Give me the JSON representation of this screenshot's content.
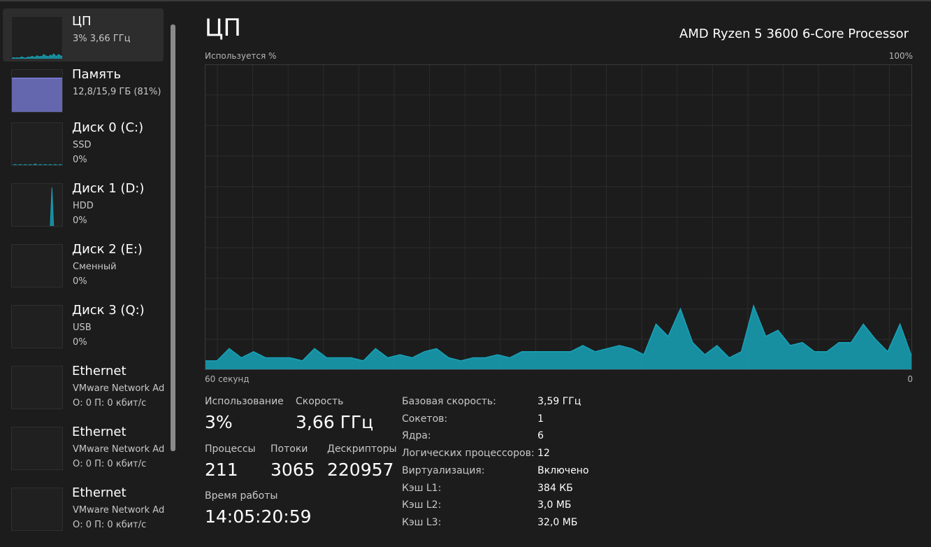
{
  "sidebar": {
    "items": [
      {
        "name": "ЦП",
        "line1": "3%  3,66 ГГц",
        "line2": "",
        "graph": "cpu",
        "color": "#17a2b8",
        "selected": true
      },
      {
        "name": "Память",
        "line1": "12,8/15,9 ГБ (81%)",
        "line2": "",
        "graph": "memory",
        "color": "#7b7fdc",
        "fill_fraction": 0.81
      },
      {
        "name": "Диск 0 (C:)",
        "line1": "SSD",
        "line2": "0%",
        "graph": "disk0",
        "color": "#17a2b8"
      },
      {
        "name": "Диск 1 (D:)",
        "line1": "HDD",
        "line2": "0%",
        "graph": "disk1",
        "color": "#17a2b8"
      },
      {
        "name": "Диск 2 (E:)",
        "line1": "Сменный",
        "line2": "0%",
        "graph": "disk2",
        "color": "#17a2b8"
      },
      {
        "name": "Диск 3 (Q:)",
        "line1": "USB",
        "line2": "0%",
        "graph": "disk3",
        "color": "#17a2b8"
      },
      {
        "name": "Ethernet",
        "line1": "VMware Network Ad",
        "line2": "О: 0  П: 0 кбит/с",
        "graph": "net",
        "color": "#c586c0"
      },
      {
        "name": "Ethernet",
        "line1": "VMware Network Ad",
        "line2": "О: 0  П: 0 кбит/с",
        "graph": "net",
        "color": "#c586c0"
      },
      {
        "name": "Ethernet",
        "line1": "VMware Network Ad",
        "line2": "О: 0  П: 0 кбит/с",
        "graph": "net",
        "color": "#c586c0"
      }
    ]
  },
  "header": {
    "title": "ЦП",
    "cpu_model": "AMD Ryzen 5 3600 6-Core Processor"
  },
  "chart_labels": {
    "y_label": "Используется %",
    "y_max": "100%",
    "x_left": "60 секунд",
    "x_right": "0"
  },
  "chart_data": {
    "type": "area",
    "title": "",
    "ylabel": "Используется %",
    "xlabel": "60 секунд",
    "ylim": [
      0,
      100
    ],
    "x_range_seconds": [
      60,
      0
    ],
    "grid": true,
    "color": "#17a2b8",
    "series": [
      {
        "values": [
          3,
          3,
          7,
          4,
          6,
          4,
          4,
          4,
          3,
          7,
          4,
          4,
          4,
          3,
          7,
          4,
          5,
          4,
          6,
          7,
          4,
          3,
          4,
          4,
          5,
          4,
          6,
          6,
          6,
          6,
          6,
          8,
          6,
          7,
          8,
          7,
          5,
          15,
          11,
          20,
          9,
          5,
          8,
          4,
          6,
          21,
          11,
          13,
          8,
          9,
          6,
          6,
          9,
          9,
          15,
          10,
          6,
          15,
          4
        ]
      }
    ]
  },
  "stats": {
    "utilization_label": "Использование",
    "utilization_value": "3%",
    "speed_label": "Скорость",
    "speed_value": "3,66 ГГц",
    "processes_label": "Процессы",
    "processes_value": "211",
    "threads_label": "Потоки",
    "threads_value": "3065",
    "handles_label": "Дескрипторы",
    "handles_value": "220957",
    "uptime_label": "Время работы",
    "uptime_value": "14:05:20:59"
  },
  "specs": [
    {
      "label": "Базовая скорость:",
      "value": "3,59 ГГц"
    },
    {
      "label": "Сокетов:",
      "value": "1"
    },
    {
      "label": "Ядра:",
      "value": "6"
    },
    {
      "label": "Логических процессоров:",
      "value": "12"
    },
    {
      "label": "Виртуализация:",
      "value": "Включено"
    },
    {
      "label": "Кэш L1:",
      "value": "384 КБ"
    },
    {
      "label": "Кэш L2:",
      "value": "3,0 МБ"
    },
    {
      "label": "Кэш L3:",
      "value": "32,0 МБ"
    }
  ]
}
